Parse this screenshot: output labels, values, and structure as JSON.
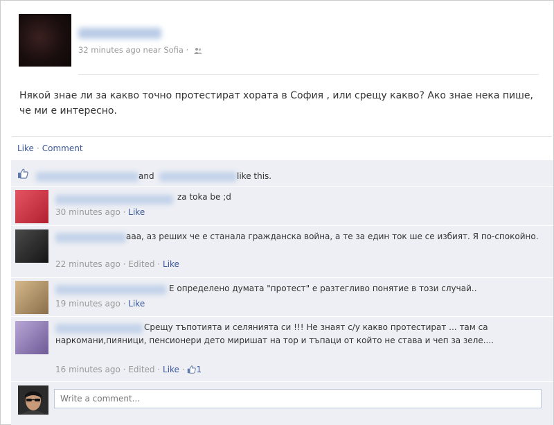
{
  "post": {
    "time": "32 minutes ago near Sofia",
    "separator": "·",
    "text": "Някой знае ли за какво точно протестират хората в София , или срещу какво? Ако знае нека пише, че ми е интересно."
  },
  "actions": {
    "like": "Like",
    "separator": "·",
    "comment": "Comment"
  },
  "likes": {
    "and": "and",
    "suffix": "like this."
  },
  "comments": [
    {
      "text": "za toka be ;d",
      "time": "30 minutes ago",
      "sep": "·",
      "like": "Like"
    },
    {
      "text": "ааа, аз реших че е станала гражданска война, а те за един ток ше се избият. Я по-спокойно.",
      "time": "22 minutes ago",
      "sep": "·",
      "edited": "Edited",
      "like": "Like"
    },
    {
      "text": "Е определено думата \"протест\" е разтегливо понятие в този случай..",
      "time": "19 minutes ago",
      "sep": "·",
      "like": "Like"
    },
    {
      "text": "Срещу тъпотията и селянията си !!! Не знаят с/у какво протестират ... там са наркомани,пияници, пенсионери дето миришат на тор и тъпаци от който не става и чеп за зеле....",
      "time": "16 minutes ago",
      "sep": "·",
      "edited": "Edited",
      "like": "Like",
      "like_count": "1"
    }
  ],
  "composer": {
    "placeholder": "Write a comment..."
  },
  "colors": {
    "link": "#3b5998",
    "feedback_bg": "#edeff4",
    "muted": "#999999"
  },
  "icons": {
    "audience": "friends-icon",
    "like": "thumbs-up-icon"
  }
}
